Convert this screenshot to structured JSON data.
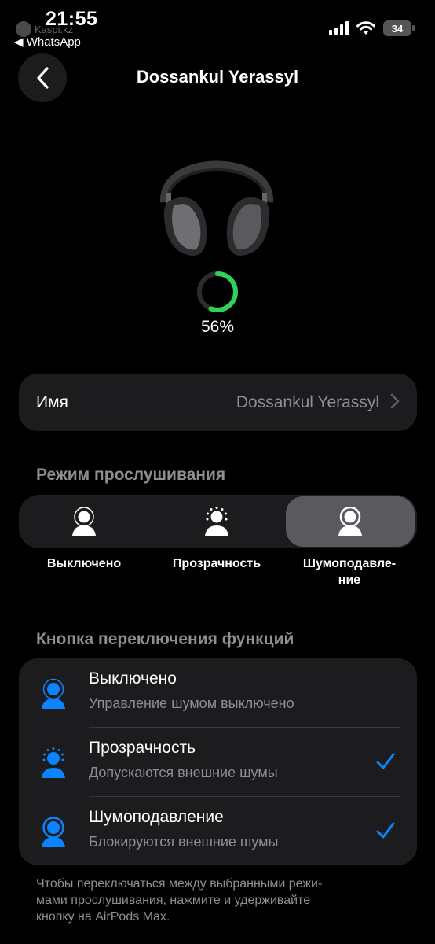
{
  "status_bar": {
    "time": "21:55",
    "overlay_text": "Kaspi.kz",
    "back_app": "◀ WhatsApp",
    "battery": "34"
  },
  "nav": {
    "title": "Dossankul Yerassyl"
  },
  "device": {
    "battery_percent": "56%",
    "battery_fraction": 0.56,
    "ring_color": "#30d158"
  },
  "name_row": {
    "label": "Имя",
    "value": "Dossankul Yerassyl"
  },
  "listening_mode": {
    "heading": "Режим прослушивания",
    "options": [
      {
        "label": "Выключено",
        "icon": "person-off-icon",
        "selected": false
      },
      {
        "label": "Прозрачность",
        "icon": "person-transparency-icon",
        "selected": false
      },
      {
        "label_line1": "Шумоподавле-",
        "label_line2": "ние",
        "icon": "person-noise-cancel-icon",
        "selected": true
      }
    ]
  },
  "toggle_button": {
    "heading": "Кнопка переключения функций",
    "items": [
      {
        "title": "Выключено",
        "subtitle": "Управление шумом выключено",
        "checked": false
      },
      {
        "title": "Прозрачность",
        "subtitle": "Допускаются внешние шумы",
        "checked": true
      },
      {
        "title": "Шумоподавление",
        "subtitle": "Блокируются внешние шумы",
        "checked": true
      }
    ],
    "accent": "#0a84ff"
  },
  "footer": {
    "line1": "Чтобы переключаться между выбранными режи-",
    "line2": "мами прослушивания, нажмите и удерживайте",
    "line3": "кнопку на AirPods Max."
  }
}
